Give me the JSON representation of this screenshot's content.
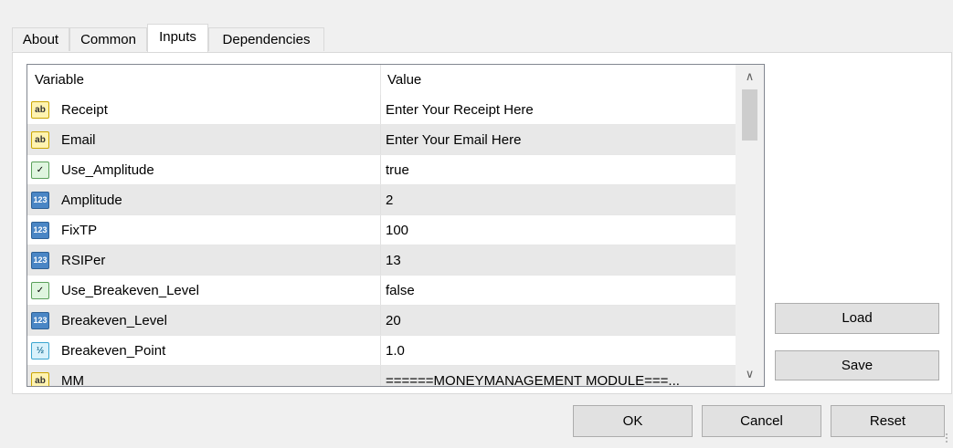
{
  "tabs": [
    {
      "label": "About"
    },
    {
      "label": "Common"
    },
    {
      "label": "Inputs"
    },
    {
      "label": "Dependencies"
    }
  ],
  "active_tab": "Inputs",
  "grid": {
    "columns": [
      "Variable",
      "Value"
    ],
    "rows": [
      {
        "icon": "ab",
        "variable": "Receipt",
        "value": "Enter Your Receipt Here"
      },
      {
        "icon": "ab",
        "variable": "Email",
        "value": "Enter Your Email Here"
      },
      {
        "icon": "bool",
        "variable": "Use_Amplitude",
        "value": "true"
      },
      {
        "icon": "123",
        "variable": "Amplitude",
        "value": "2"
      },
      {
        "icon": "123",
        "variable": "FixTP",
        "value": "100"
      },
      {
        "icon": "123",
        "variable": "RSIPer",
        "value": "13"
      },
      {
        "icon": "bool",
        "variable": "Use_Breakeven_Level",
        "value": "false"
      },
      {
        "icon": "123",
        "variable": "Breakeven_Level",
        "value": "20"
      },
      {
        "icon": "1/2",
        "variable": "Breakeven_Point",
        "value": "1.0"
      },
      {
        "icon": "ab",
        "variable": "MM",
        "value": "======MONEYMANAGEMENT MODULE===..."
      }
    ]
  },
  "icon_glyphs": {
    "ab": "ab",
    "123": "123",
    "1/2": "½",
    "bool": "✓"
  },
  "buttons": {
    "load": "Load",
    "save": "Save",
    "ok": "OK",
    "cancel": "Cancel",
    "reset": "Reset"
  }
}
